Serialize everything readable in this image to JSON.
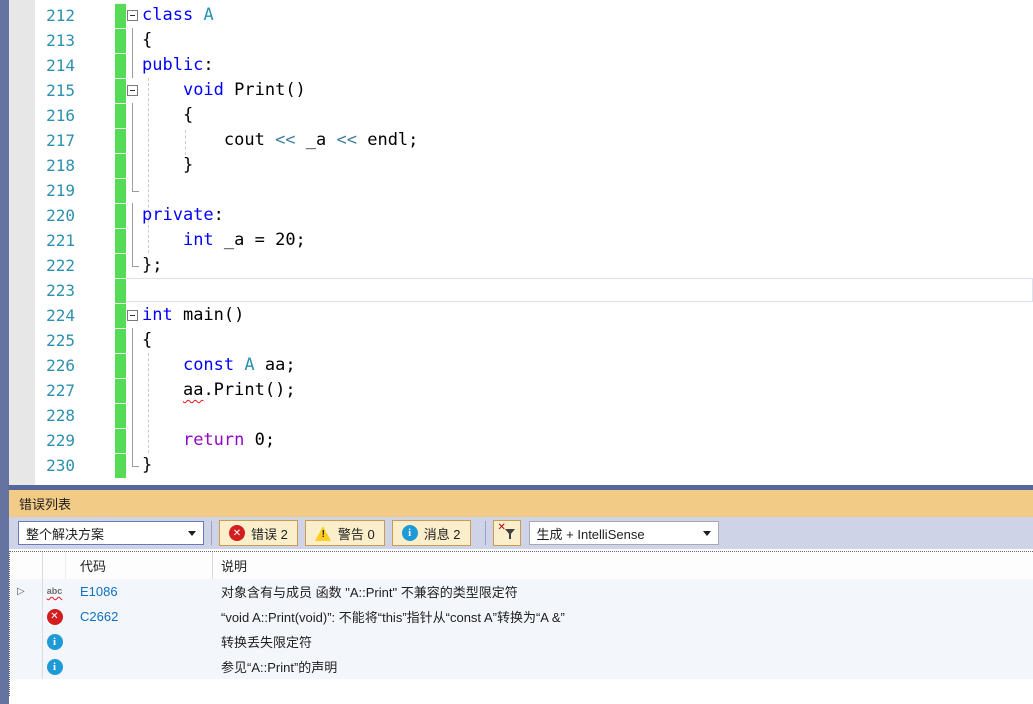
{
  "editor": {
    "lines": [
      {
        "num": "212",
        "outline": "box",
        "segments": [
          {
            "t": "class",
            "s": "kw"
          },
          {
            "t": " ",
            "s": "p"
          },
          {
            "t": "A",
            "s": "type"
          }
        ]
      },
      {
        "num": "213",
        "outline": "line",
        "segments": [
          {
            "t": "{",
            "s": "p"
          }
        ]
      },
      {
        "num": "214",
        "outline": "line",
        "segments": [
          {
            "t": "public",
            "s": "kw"
          },
          {
            "t": ":",
            "s": "p"
          }
        ]
      },
      {
        "num": "215",
        "outline": "box",
        "segments": [
          {
            "t": "    ",
            "s": "p"
          },
          {
            "t": "void",
            "s": "kw"
          },
          {
            "t": " Print()",
            "s": "p"
          }
        ]
      },
      {
        "num": "216",
        "outline": "line",
        "segments": [
          {
            "t": "    {",
            "s": "p"
          }
        ]
      },
      {
        "num": "217",
        "outline": "line",
        "segments": [
          {
            "t": "        cout ",
            "s": "p"
          },
          {
            "t": "<<",
            "s": "op"
          },
          {
            "t": " _a ",
            "s": "p"
          },
          {
            "t": "<<",
            "s": "op"
          },
          {
            "t": " endl;",
            "s": "p"
          }
        ]
      },
      {
        "num": "218",
        "outline": "line",
        "segments": [
          {
            "t": "    }",
            "s": "p"
          }
        ]
      },
      {
        "num": "219",
        "outline": "corner",
        "segments": []
      },
      {
        "num": "220",
        "outline": "line",
        "segments": [
          {
            "t": "private",
            "s": "kw"
          },
          {
            "t": ":",
            "s": "p"
          }
        ]
      },
      {
        "num": "221",
        "outline": "line",
        "segments": [
          {
            "t": "    ",
            "s": "p"
          },
          {
            "t": "int",
            "s": "kw"
          },
          {
            "t": " _a = 20;",
            "s": "p"
          }
        ]
      },
      {
        "num": "222",
        "outline": "corner",
        "segments": [
          {
            "t": "};",
            "s": "p"
          }
        ]
      },
      {
        "num": "223",
        "outline": "none",
        "segments": [],
        "current": true
      },
      {
        "num": "224",
        "outline": "box",
        "segments": [
          {
            "t": "int",
            "s": "kw"
          },
          {
            "t": " main()",
            "s": "p"
          }
        ]
      },
      {
        "num": "225",
        "outline": "line",
        "segments": [
          {
            "t": "{",
            "s": "p"
          }
        ]
      },
      {
        "num": "226",
        "outline": "line",
        "segments": [
          {
            "t": "    ",
            "s": "p"
          },
          {
            "t": "const",
            "s": "kw"
          },
          {
            "t": " ",
            "s": "p"
          },
          {
            "t": "A",
            "s": "type"
          },
          {
            "t": " aa;",
            "s": "p"
          }
        ]
      },
      {
        "num": "227",
        "outline": "line",
        "segments": [
          {
            "t": "    ",
            "s": "p"
          },
          {
            "t": "aa",
            "s": "err"
          },
          {
            "t": ".Print();",
            "s": "p"
          }
        ]
      },
      {
        "num": "228",
        "outline": "line",
        "segments": []
      },
      {
        "num": "229",
        "outline": "line",
        "segments": [
          {
            "t": "    ",
            "s": "p"
          },
          {
            "t": "return",
            "s": "ctrl"
          },
          {
            "t": " 0;",
            "s": "p"
          }
        ]
      },
      {
        "num": "230",
        "outline": "corner",
        "segments": [
          {
            "t": "}",
            "s": "p"
          }
        ]
      }
    ]
  },
  "panel": {
    "title": "错误列表",
    "toolbar": {
      "scope_dropdown": "整个解决方案",
      "errors_label": "错误 2",
      "warnings_label": "警告 0",
      "messages_label": "消息 2",
      "source_dropdown": "生成 + IntelliSense"
    },
    "table": {
      "columns": [
        "代码",
        "说明"
      ],
      "rows": [
        {
          "expander": true,
          "icon": "intellisense-error",
          "code": "E1086",
          "description": "对象含有与成员 函数 \"A::Print\" 不兼容的类型限定符"
        },
        {
          "expander": false,
          "icon": "error",
          "code": "C2662",
          "description": "“void A::Print(void)”: 不能将“this”指针从“const A”转换为“A &”"
        },
        {
          "expander": false,
          "icon": "info",
          "code": "",
          "description": "转换丢失限定符"
        },
        {
          "expander": false,
          "icon": "info",
          "code": "",
          "description": "参见“A::Print”的声明"
        }
      ]
    }
  },
  "icons": {
    "error_x": "✕",
    "warning_excl": "!",
    "info_i": "i",
    "filter_x": "✕",
    "expander": "▷",
    "abc": "abc"
  },
  "colors": {
    "titlebar_orange": "#F2CB87",
    "toolbar_lavender": "#CED3E8",
    "window_edge_slate": "#64739F",
    "keyword_blue": "#0000FF",
    "type_teal": "#2B91AF",
    "control_purple": "#8F08C4",
    "line_number_teal": "#2B91AF",
    "change_bar_green": "#55DB55",
    "error_red": "#D21E1E",
    "info_blue": "#1E9BD7",
    "warning_yellow": "#FFCE21",
    "code_link_blue": "#0E70C0",
    "squiggle_red": "#E81123"
  }
}
